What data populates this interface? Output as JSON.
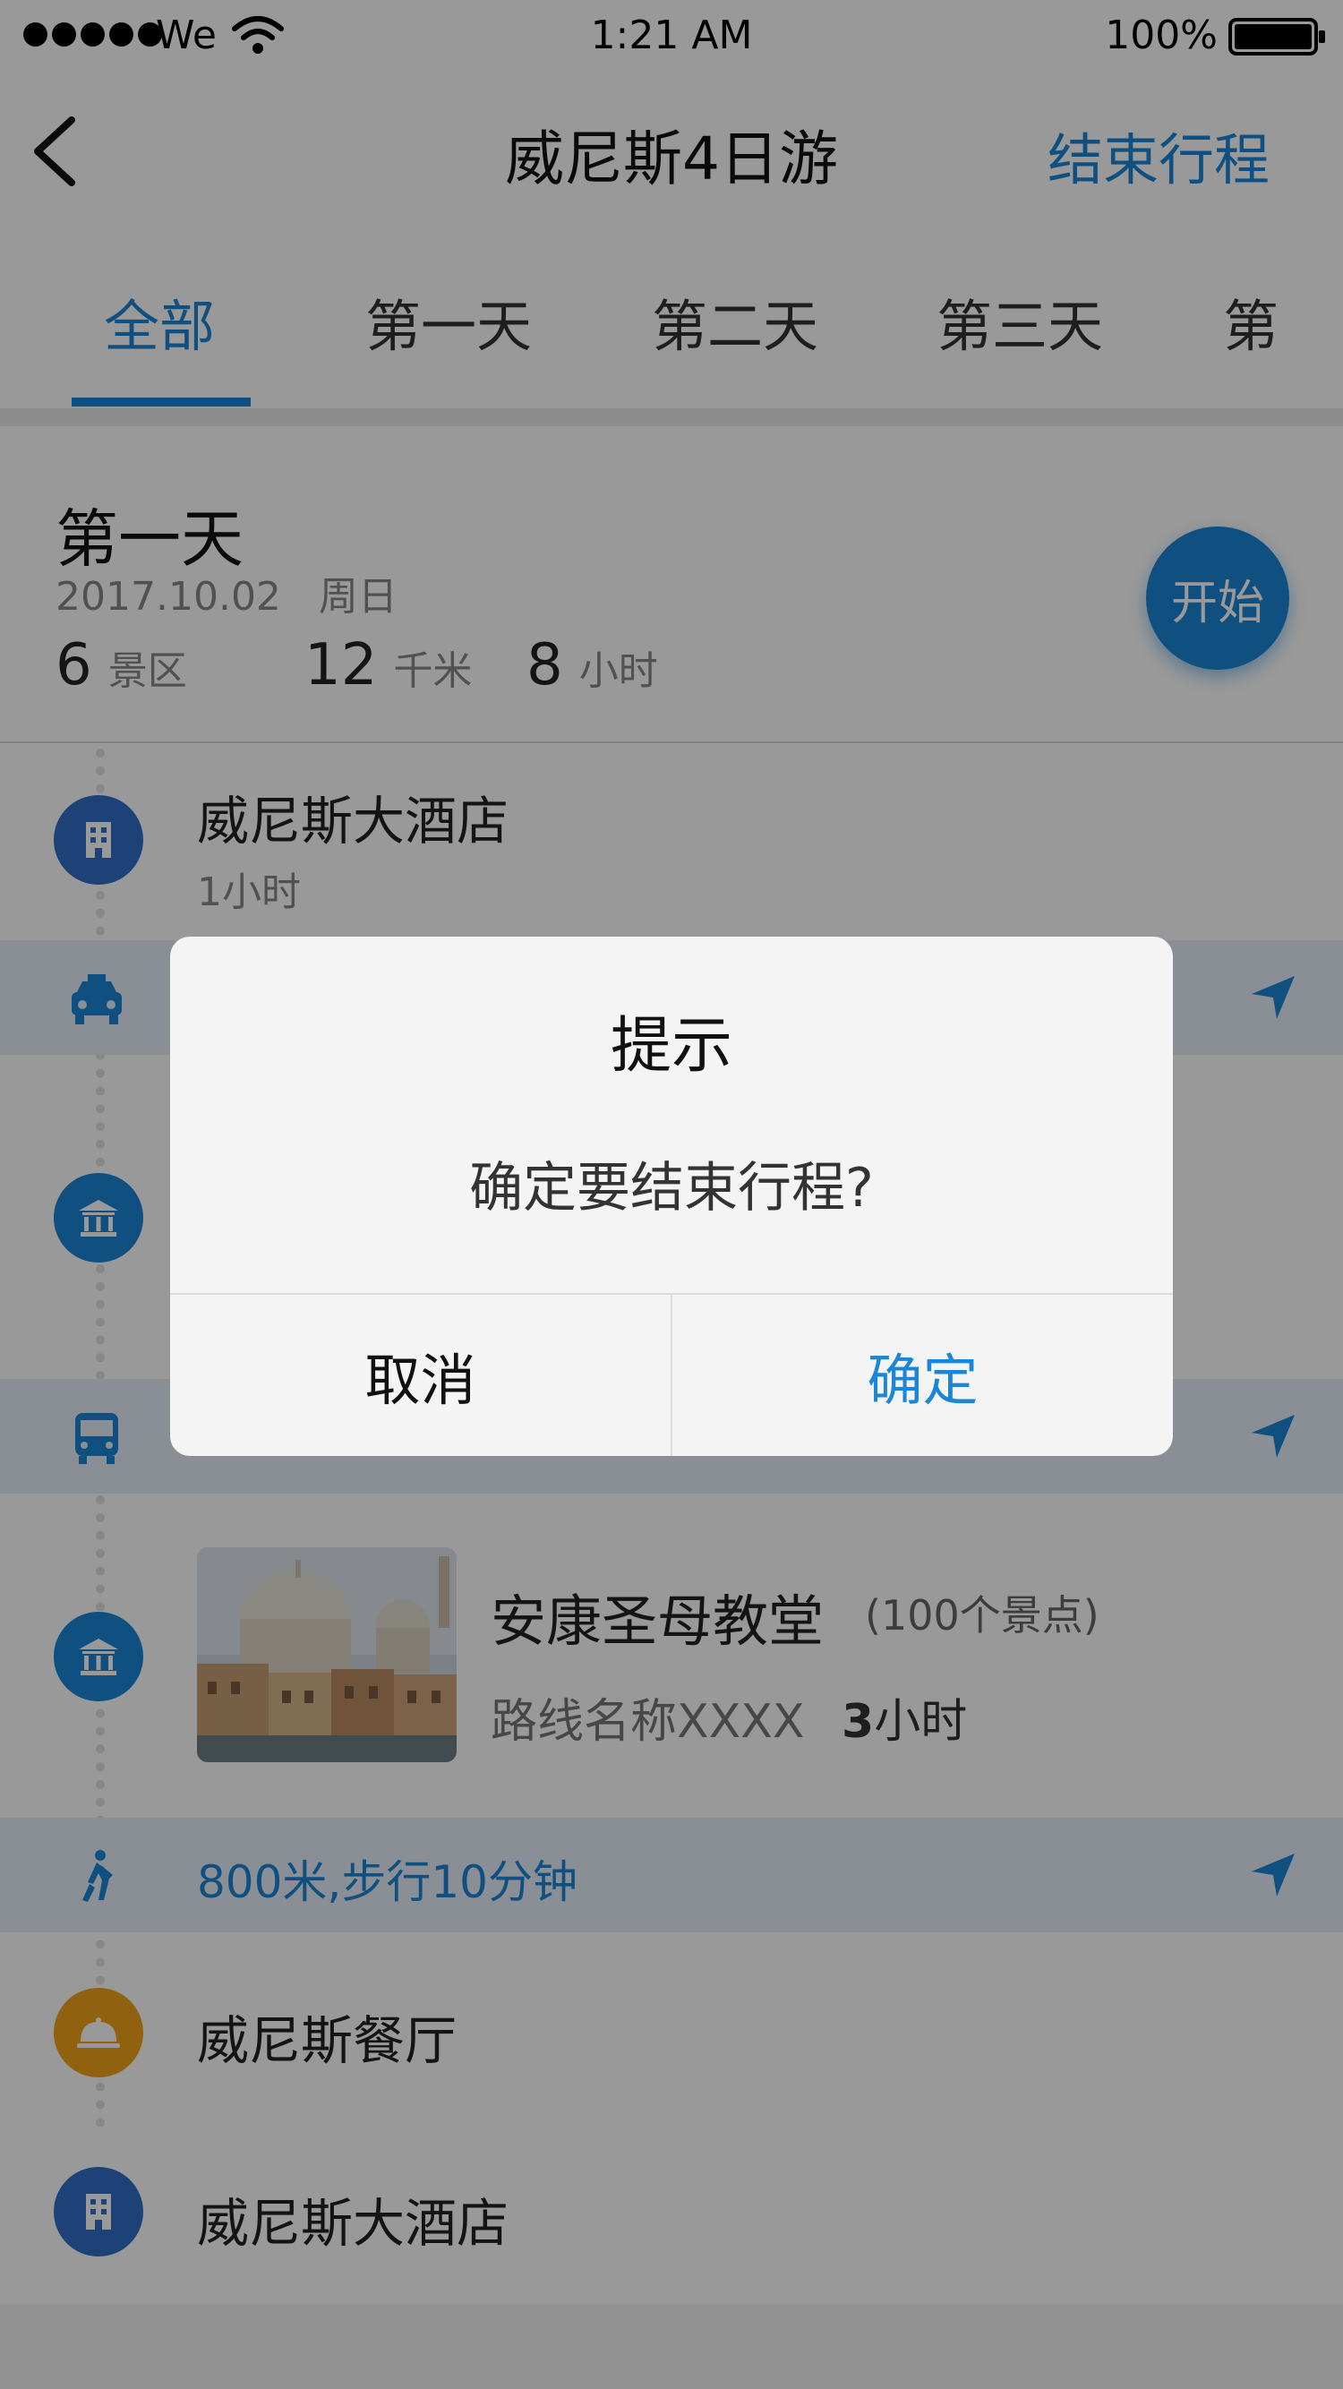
{
  "status_bar": {
    "carrier": "We",
    "time": "1:21 AM",
    "battery": "100%"
  },
  "nav": {
    "title": "威尼斯4日游",
    "end_trip_label": "结束行程",
    "back_icon": "chevron-left-icon"
  },
  "tabs": [
    {
      "label": "全部",
      "active": true
    },
    {
      "label": "第一天",
      "active": false
    },
    {
      "label": "第二天",
      "active": false
    },
    {
      "label": "第三天",
      "active": false
    },
    {
      "label": "第",
      "active": false
    }
  ],
  "day": {
    "title": "第一天",
    "date": "2017.10.02",
    "weekday": "周日",
    "stats": [
      {
        "value": "6",
        "unit": "景区"
      },
      {
        "value": "12",
        "unit": "千米"
      },
      {
        "value": "8",
        "unit": "小时"
      }
    ],
    "start_label": "开始"
  },
  "itinerary": {
    "hotel_1": {
      "name": "威尼斯大酒店",
      "duration": "1小时",
      "icon": "hotel-icon"
    },
    "transit_1": {
      "icon": "taxi-icon",
      "text": ""
    },
    "transit_2": {
      "icon": "bus-icon",
      "text": ""
    },
    "attraction": {
      "name": "安康圣母教堂",
      "count": "(100个景点)",
      "route": "路线名称XXXX",
      "hours_num": "3",
      "hours_unit": "小时",
      "icon": "museum-icon"
    },
    "transit_walk": {
      "icon": "walking-icon",
      "text": "800米,步行10分钟"
    },
    "restaurant": {
      "name": "威尼斯餐厅",
      "icon": "restaurant-bell-icon"
    },
    "hotel_2": {
      "name": "威尼斯大酒店",
      "icon": "hotel-icon"
    }
  },
  "dialog": {
    "title": "提示",
    "message": "确定要结束行程?",
    "cancel_label": "取消",
    "confirm_label": "确定"
  },
  "colors": {
    "accent": "#1a86d8",
    "restaurant": "#f0a21a",
    "hotel": "#2f6fc7",
    "transit_band": "#e5eef7"
  }
}
